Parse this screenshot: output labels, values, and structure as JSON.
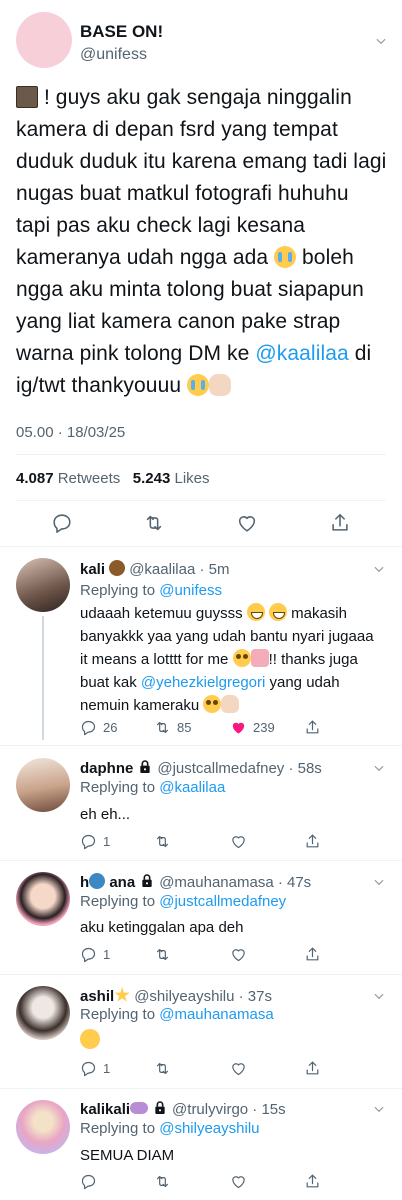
{
  "main_tweet": {
    "name": "BASE ON!",
    "handle": "@unifess",
    "text_parts": [
      "! guys aku gak sengaja ninggalin kamera di depan fsrd yang tempat duduk duduk itu karena emang tadi lagi nugas buat matkul fotografi huhuhu tapi pas aku check lagi kesana kameranya udah ngga ada ",
      " boleh ngga aku minta tolong buat siapapun yang liat kamera canon pake strap warna pink tolong DM ke ",
      "@kaalilaa",
      " di ig/twt thankyouuu "
    ],
    "timestamp": "05.00 · 18/03/25",
    "retweets_count": "4.087",
    "retweets_label": "Retweets",
    "likes_count": "5.243",
    "likes_label": "Likes"
  },
  "replies": [
    {
      "name": "kali",
      "name_emoji": "coconut",
      "handle": "@kaalilaa · 5m",
      "replying_prefix": "Replying to",
      "replying_to": "@unifess",
      "text_parts": [
        "udaaah ketemuu guysss ",
        " makasih banyakkk yaa yang udah bantu nyari jugaaa it means a lotttt for me ",
        "!! thanks juga buat kak ",
        "@yehezkielgregori",
        " yang udah nemuin kameraku "
      ],
      "replies": "26",
      "retweets": "85",
      "likes": "239",
      "liked_color": "#f91880"
    },
    {
      "name": "daphne",
      "handle": "@justcallmedafney · 58s",
      "replying_prefix": "Replying to",
      "replying_to": "@kaalilaa",
      "text": "eh eh...",
      "replies": "1"
    },
    {
      "name_a": "h",
      "name_b": "ana",
      "handle": "@mauhanamasa · 47s",
      "replying_prefix": "Replying to",
      "replying_to": "@justcallmedafney",
      "text": "aku ketinggalan apa deh",
      "replies": "1"
    },
    {
      "name": "ashil",
      "handle": "@shilyeayshilu · 37s",
      "replying_prefix": "Replying to",
      "replying_to": "@mauhanamasa",
      "replies": "1"
    },
    {
      "name": "kalikali",
      "handle": "@trulyvirgo · 15s",
      "replying_prefix": "Replying to",
      "replying_to": "@shilyeayshilu",
      "text": "SEMUA DIAM"
    }
  ],
  "icons": [
    "chevron-down-icon",
    "reply-icon",
    "retweet-icon",
    "like-icon",
    "share-icon",
    "lock-icon"
  ],
  "colors": {
    "link": "#1d9bf0",
    "muted": "#536471",
    "like": "#f91880"
  }
}
